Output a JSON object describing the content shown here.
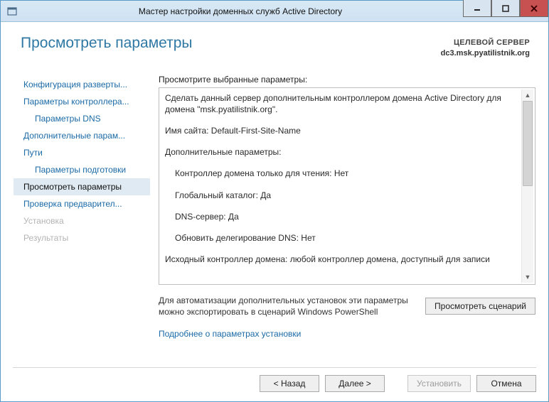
{
  "titlebar": {
    "title": "Мастер настройки доменных служб Active Directory"
  },
  "header": {
    "page_title": "Просмотреть параметры",
    "target_label": "ЦЕЛЕВОЙ СЕРВЕР",
    "target_name": "dc3.msk.pyatilistnik.org"
  },
  "steps": [
    {
      "label": "Конфигурация разверты...",
      "indent": false,
      "state": "normal"
    },
    {
      "label": "Параметры контроллера...",
      "indent": false,
      "state": "normal"
    },
    {
      "label": "Параметры DNS",
      "indent": true,
      "state": "normal"
    },
    {
      "label": "Дополнительные парам...",
      "indent": false,
      "state": "normal"
    },
    {
      "label": "Пути",
      "indent": false,
      "state": "normal"
    },
    {
      "label": "Параметры подготовки",
      "indent": true,
      "state": "normal"
    },
    {
      "label": "Просмотреть параметры",
      "indent": false,
      "state": "selected"
    },
    {
      "label": "Проверка предварител...",
      "indent": false,
      "state": "normal"
    },
    {
      "label": "Установка",
      "indent": false,
      "state": "disabled"
    },
    {
      "label": "Результаты",
      "indent": false,
      "state": "disabled"
    }
  ],
  "main": {
    "prompt": "Просмотрите выбранные параметры:",
    "review": {
      "line1": "Сделать данный сервер дополнительным контроллером домена Active Directory для домена \"msk.pyatilistnik.org\".",
      "line2": "Имя сайта: Default-First-Site-Name",
      "line3": "Дополнительные параметры:",
      "sub1": "Контроллер домена только для чтения: Нет",
      "sub2": "Глобальный каталог: Да",
      "sub3": "DNS-сервер: Да",
      "sub4": "Обновить делегирование DNS: Нет",
      "line4": "Исходный контроллер домена: любой контроллер домена, доступный для записи"
    },
    "export_text": "Для автоматизации дополнительных установок эти параметры можно экспортировать в сценарий Windows PowerShell",
    "view_script_btn": "Просмотреть сценарий",
    "more_link": "Подробнее о параметрах установки"
  },
  "footer": {
    "back": "< Назад",
    "next": "Далее >",
    "install": "Установить",
    "cancel": "Отмена"
  }
}
